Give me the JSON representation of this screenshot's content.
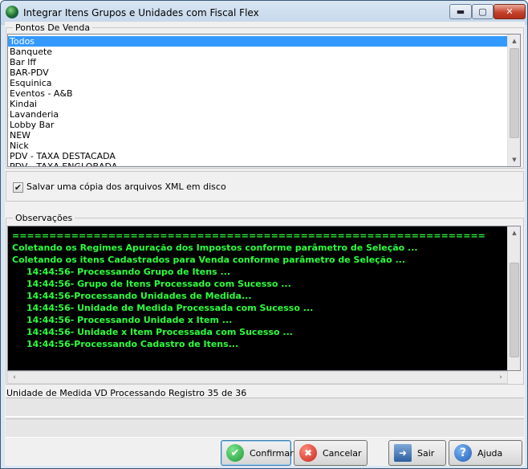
{
  "window": {
    "title": "Integrar Itens Grupos e Unidades com Fiscal Flex",
    "controls": {
      "minimize": "▬",
      "maximize": "▢",
      "close": "✕"
    }
  },
  "pontos_de_venda": {
    "label": "Pontos De Venda",
    "items": [
      "Todos",
      "Banquete",
      "Bar lff",
      "BAR-PDV",
      "Esquinica",
      "Eventos - A&B",
      "Kindai",
      "Lavanderia",
      "Lobby Bar",
      "NEW",
      "Nick",
      "PDV - TAXA DESTACADA",
      "PDV - TAXA ENGLOBADA"
    ],
    "selected": "Todos"
  },
  "options": {
    "save_xml_label": "Salvar uma cópia dos arquivos XML em disco",
    "save_xml_checked": true,
    "check_glyph": "✔"
  },
  "observacoes": {
    "label": "Observações",
    "lines": [
      {
        "text": "================================================================",
        "indent": false
      },
      {
        "text": "Coletando os Regimes Apuração dos Impostos conforme parâmetro de Seleção ...",
        "indent": false
      },
      {
        "text": "Coletando os itens Cadastrados para Venda  conforme parâmetro de Seleção ...",
        "indent": false
      },
      {
        "text": "14:44:56- Processando Grupo de Itens ...",
        "indent": true
      },
      {
        "text": "14:44:56- Grupo de Itens Processado com Sucesso ...",
        "indent": true
      },
      {
        "text": "14:44:56-Processando Unidades de Medida...",
        "indent": true
      },
      {
        "text": "14:44:56- Unidade de Medida Processada com Sucesso ...",
        "indent": true
      },
      {
        "text": "14:44:56- Processando Unidade x Item ...",
        "indent": true
      },
      {
        "text": "14:44:56- Unidade x Item Processada com Sucesso ...",
        "indent": true
      },
      {
        "text": "14:44:56-Processando Cadastro de Itens...",
        "indent": true
      }
    ]
  },
  "status": {
    "text": "Unidade de Medida VD Processando Registro 35 de 36"
  },
  "buttons": {
    "confirmar": {
      "label": "Confirmar",
      "icon_glyph": "✔"
    },
    "cancelar": {
      "label": "Cancelar",
      "icon_glyph": "✖"
    },
    "sair": {
      "label": "Sair",
      "icon_glyph": "➜"
    },
    "ajuda": {
      "label": "Ajuda",
      "icon_glyph": "?"
    }
  },
  "colors": {
    "log_text": "#2bff3c",
    "log_background": "#000000",
    "selection": "#3399ff"
  }
}
